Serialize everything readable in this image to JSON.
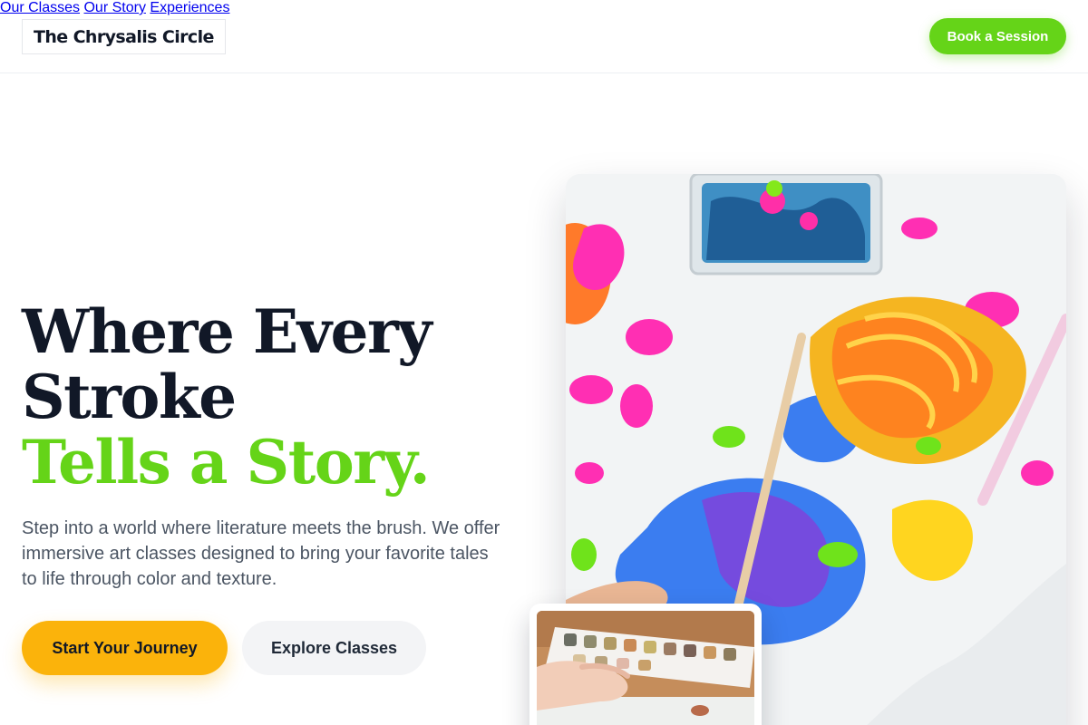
{
  "header": {
    "logo": "The Chrysalis Circle",
    "nav": [
      "Our Classes",
      "Our Story",
      "Experiences"
    ],
    "cta": "Book a Session"
  },
  "hero": {
    "title_line1": "Where Every",
    "title_line2": "Stroke",
    "title_accent": "Tells a Story.",
    "subtitle": "Step into a world where literature meets the brush. We offer immersive art classes designed to bring your favorite tales to life through color and texture.",
    "primary_cta": "Start Your Journey",
    "secondary_cta": "Explore Classes"
  },
  "colors": {
    "accent_green": "#65d418",
    "accent_yellow": "#fbb30b",
    "text_dark": "#111827",
    "text_muted": "#4b5563"
  }
}
